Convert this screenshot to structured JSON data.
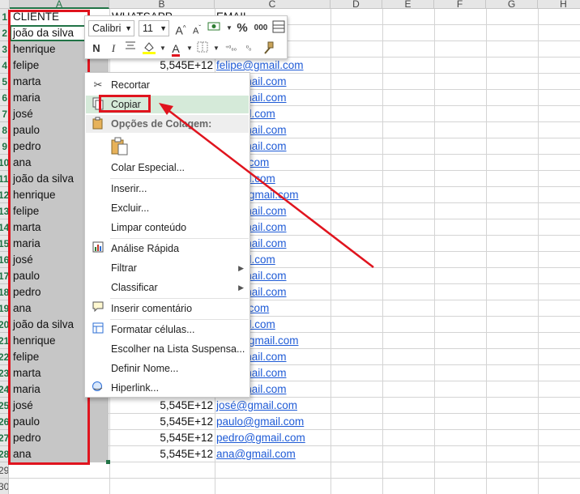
{
  "columns": {
    "a": "A",
    "b": "B",
    "c": "C",
    "d": "D",
    "e": "E",
    "f": "F",
    "g": "G",
    "h": "H"
  },
  "rows": [
    {
      "num": "1",
      "a": "CLIENTE",
      "b": "WHATSAPP",
      "c": "EMAIL"
    },
    {
      "num": "2",
      "a": "joão da silva",
      "b": "",
      "c": "...com"
    },
    {
      "num": "3",
      "a": "henrique",
      "b": "",
      "c": "...ail.com"
    },
    {
      "num": "4",
      "a": "felipe",
      "b": "5,545E+12",
      "c": "felipe@gmail.com"
    },
    {
      "num": "5",
      "a": "marta",
      "b": "",
      "c": "...@gmail.com"
    },
    {
      "num": "6",
      "a": "maria",
      "b": "",
      "c": "...@gmail.com"
    },
    {
      "num": "7",
      "a": "josé",
      "b": "",
      "c": "...gmail.com"
    },
    {
      "num": "8",
      "a": "paulo",
      "b": "",
      "c": "...@gmail.com"
    },
    {
      "num": "9",
      "a": "pedro",
      "b": "",
      "c": "...@gmail.com"
    },
    {
      "num": "10",
      "a": "ana",
      "b": "",
      "c": "...mail.com"
    },
    {
      "num": "11",
      "a": "joão da silva",
      "b": "",
      "c": "...gmail.com"
    },
    {
      "num": "12",
      "a": "henrique",
      "b": "",
      "c": "...ue@gmail.com"
    },
    {
      "num": "13",
      "a": "felipe",
      "b": "",
      "c": "...@gmail.com"
    },
    {
      "num": "14",
      "a": "marta",
      "b": "",
      "c": "...@gmail.com"
    },
    {
      "num": "15",
      "a": "maria",
      "b": "",
      "c": "...@gmail.com"
    },
    {
      "num": "16",
      "a": "josé",
      "b": "",
      "c": "...gmail.com"
    },
    {
      "num": "17",
      "a": "paulo",
      "b": "",
      "c": "...@gmail.com"
    },
    {
      "num": "18",
      "a": "pedro",
      "b": "",
      "c": "...@gmail.com"
    },
    {
      "num": "19",
      "a": "ana",
      "b": "",
      "c": "...mail.com"
    },
    {
      "num": "20",
      "a": "joão da silva",
      "b": "",
      "c": "...gmail.com"
    },
    {
      "num": "21",
      "a": "henrique",
      "b": "",
      "c": "...ue@gmail.com"
    },
    {
      "num": "22",
      "a": "felipe",
      "b": "",
      "c": "...@gmail.com"
    },
    {
      "num": "23",
      "a": "marta",
      "b": "",
      "c": "...@gmail.com"
    },
    {
      "num": "24",
      "a": "maria",
      "b": "",
      "c": "...@gmail.com"
    },
    {
      "num": "25",
      "a": "josé",
      "b": "5,545E+12",
      "c": "josé@gmail.com"
    },
    {
      "num": "26",
      "a": "paulo",
      "b": "5,545E+12",
      "c": "paulo@gmail.com"
    },
    {
      "num": "27",
      "a": "pedro",
      "b": "5,545E+12",
      "c": "pedro@gmail.com"
    },
    {
      "num": "28",
      "a": "ana",
      "b": "5,545E+12",
      "c": "ana@gmail.com"
    },
    {
      "num": "29",
      "a": "",
      "b": "",
      "c": ""
    },
    {
      "num": "30",
      "a": "",
      "b": "",
      "c": ""
    }
  ],
  "mini_toolbar": {
    "font_name": "Calibri",
    "font_size": "11",
    "grow_font": "A",
    "shrink_font": "A",
    "currency": "$",
    "percent": "%",
    "thousands": "000",
    "bold": "N",
    "italic": "I",
    "font_color_letter": "A",
    "inc_decimal": "⁺⁰₀₀",
    "dec_decimal": "⁰₀"
  },
  "context_menu": {
    "cut": "Recortar",
    "copy": "Copiar",
    "paste_options": "Opções de Colagem:",
    "paste_special": "Colar Especial...",
    "insert": "Inserir...",
    "delete": "Excluir...",
    "clear": "Limpar conteúdo",
    "quick_analysis": "Análise Rápida",
    "filter": "Filtrar",
    "sort": "Classificar",
    "insert_comment": "Inserir comentário",
    "format_cells": "Formatar células...",
    "pick_list": "Escolher na Lista Suspensa...",
    "define_name": "Definir Nome...",
    "hyperlink": "Hiperlink..."
  },
  "colors": {
    "annotation_red": "#e0141e",
    "selection_gray": "#c6c6c6",
    "excel_green": "#217346",
    "link_blue": "#1f5bd6",
    "hover_green": "#d5ead9"
  }
}
